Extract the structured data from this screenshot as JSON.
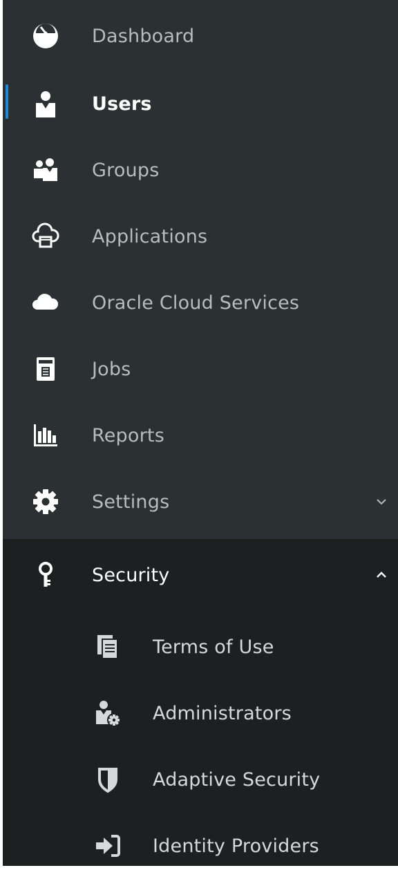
{
  "nav": {
    "items": [
      {
        "label": "Dashboard",
        "icon": "dashboard-icon"
      },
      {
        "label": "Users",
        "icon": "user-icon",
        "active": true
      },
      {
        "label": "Groups",
        "icon": "groups-icon"
      },
      {
        "label": "Applications",
        "icon": "cloud-app-icon"
      },
      {
        "label": "Oracle Cloud Services",
        "icon": "cloud-icon"
      },
      {
        "label": "Jobs",
        "icon": "jobs-icon"
      },
      {
        "label": "Reports",
        "icon": "bar-chart-icon"
      },
      {
        "label": "Settings",
        "icon": "gear-icon",
        "expanded": false
      }
    ],
    "security": {
      "label": "Security",
      "icon": "key-icon",
      "expanded": true,
      "children": [
        {
          "label": "Terms of Use",
          "icon": "documents-icon"
        },
        {
          "label": "Administrators",
          "icon": "admin-user-icon"
        },
        {
          "label": "Adaptive Security",
          "icon": "shield-icon"
        },
        {
          "label": "Identity Providers",
          "icon": "sign-in-icon"
        }
      ]
    }
  },
  "colors": {
    "sidebar_bg": "#2b3032",
    "section_bg": "#1e1f20",
    "accent": "#1c8ad9",
    "text_muted": "#b7bdbf",
    "text_active": "#ffffff"
  }
}
